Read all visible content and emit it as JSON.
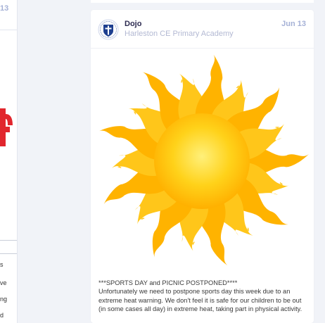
{
  "left_column": {
    "date_fragment": "13",
    "word_fragments": [
      "s",
      "ve",
      "ng",
      "d"
    ]
  },
  "post": {
    "author": "Dojo",
    "school": "Harleston CE Primary Academy",
    "date": "Jun 13",
    "image_icon": "sun-image",
    "title": "***SPORTS DAY and PICNIC POSTPONED****",
    "body": "Unfortunately we need to postpone sports day this week due to an extreme heat warning. We don't feel it is safe for our children to be out (in some cases all day) in extreme heat, taking part in physical activity."
  },
  "colors": {
    "accent": "#a5b1d6",
    "author": "#2c2a50",
    "background": "#f1f3f8",
    "sun_core": "#ffd21a",
    "sun_rays": "#ffb300"
  }
}
